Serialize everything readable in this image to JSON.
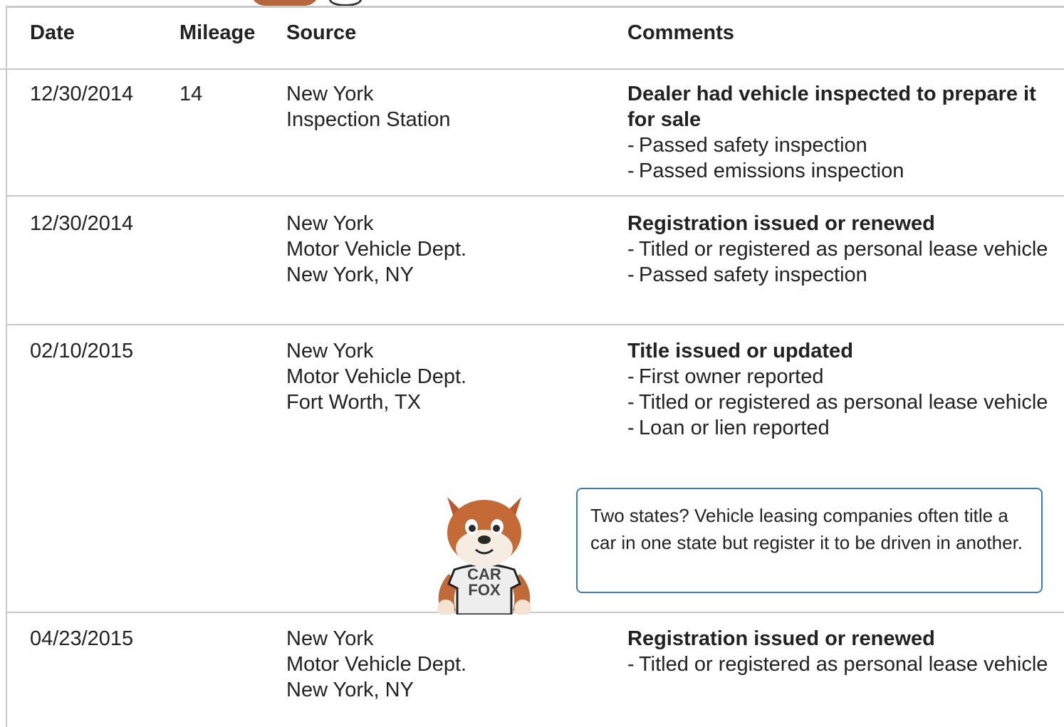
{
  "columns": {
    "date": "Date",
    "mileage": "Mileage",
    "source": "Source",
    "comments": "Comments"
  },
  "records": [
    {
      "date": "12/30/2014",
      "mileage": "14",
      "source": [
        "New York",
        "Inspection Station"
      ],
      "title": "Dealer had vehicle inspected to prepare it for sale",
      "details": [
        "Passed safety inspection",
        "Passed emissions inspection"
      ]
    },
    {
      "date": "12/30/2014",
      "mileage": "",
      "source": [
        "New York",
        "Motor Vehicle Dept.",
        "New York, NY"
      ],
      "title": "Registration issued or renewed",
      "details": [
        "Titled or registered as personal lease vehicle",
        "Passed safety inspection"
      ]
    },
    {
      "date": "02/10/2015",
      "mileage": "",
      "source": [
        "New York",
        "Motor Vehicle Dept.",
        "Fort Worth, TX"
      ],
      "title": "Title issued or updated",
      "details": [
        "First owner reported",
        "Titled or registered as personal lease vehicle",
        "Loan or lien reported"
      ]
    },
    {
      "date": "04/23/2015",
      "mileage": "",
      "source": [
        "New York",
        "Motor Vehicle Dept.",
        "New York, NY"
      ],
      "title": "Registration issued or renewed",
      "details": [
        "Titled or registered as personal lease vehicle"
      ]
    }
  ],
  "tip": {
    "text": "Two states? Vehicle leasing companies often title a car in one state but register it to be driven in another.",
    "mascot_icon": "carfox-mascot-icon",
    "shirt_line1": "CAR",
    "shirt_line2": "FOX",
    "border_color": "#3a7cc4"
  },
  "colors": {
    "border": "#c8c8c8",
    "text": "#222222"
  }
}
